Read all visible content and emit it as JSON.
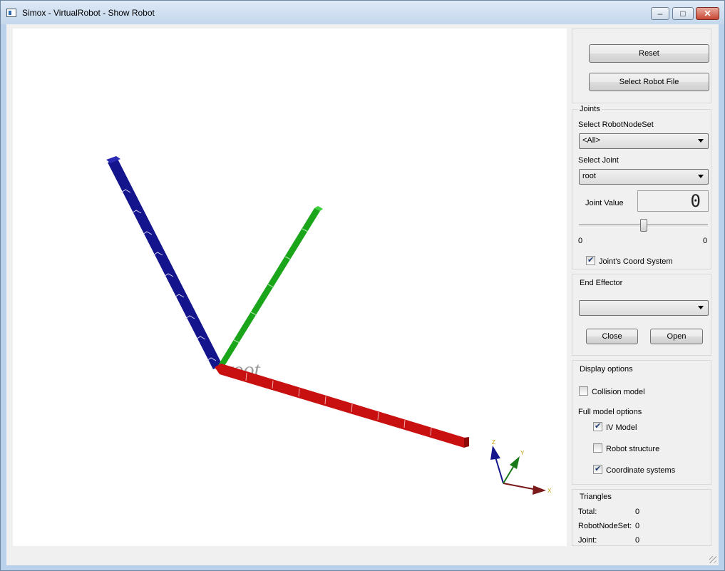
{
  "window": {
    "title": "Simox - VirtualRobot - Show Robot",
    "minimize_glyph": "–",
    "maximize_glyph": "□",
    "close_glyph": "✕"
  },
  "viewer": {
    "root_label": "root",
    "axis_labels": {
      "x": "X",
      "y": "Y",
      "z": "Z"
    }
  },
  "panel": {
    "reset_label": "Reset",
    "select_robot_file_label": "Select Robot File",
    "joints": {
      "title": "Joints",
      "robot_node_set_label": "Select RobotNodeSet",
      "robot_node_set_value": "<All>",
      "select_joint_label": "Select Joint",
      "select_joint_value": "root",
      "joint_value_label": "Joint Value",
      "joint_value_display": "0",
      "slider_min": "0",
      "slider_max": "0",
      "slider_position": 0.5,
      "coord_system_label": "Joint's Coord System",
      "coord_system_checked": true
    },
    "end_effector": {
      "title": "End Effector",
      "value": "",
      "close_label": "Close",
      "open_label": "Open"
    },
    "display": {
      "title": "Display options",
      "collision_model_label": "Collision model",
      "collision_model_checked": false,
      "full_model_label": "Full model options",
      "iv_model_label": "IV Model",
      "iv_model_checked": true,
      "robot_structure_label": "Robot structure",
      "robot_structure_checked": false,
      "coordinate_systems_label": "Coordinate systems",
      "coordinate_systems_checked": true
    },
    "triangles": {
      "title": "Triangles",
      "total_label": "Total:",
      "total_value": "0",
      "robot_node_set_label": "RobotNodeSet:",
      "robot_node_set_value": "0",
      "joint_label": "Joint:",
      "joint_value": "0"
    }
  },
  "colors": {
    "x_axis": "#c81010",
    "y_axis": "#1aa51a",
    "z_axis": "#14148c"
  }
}
